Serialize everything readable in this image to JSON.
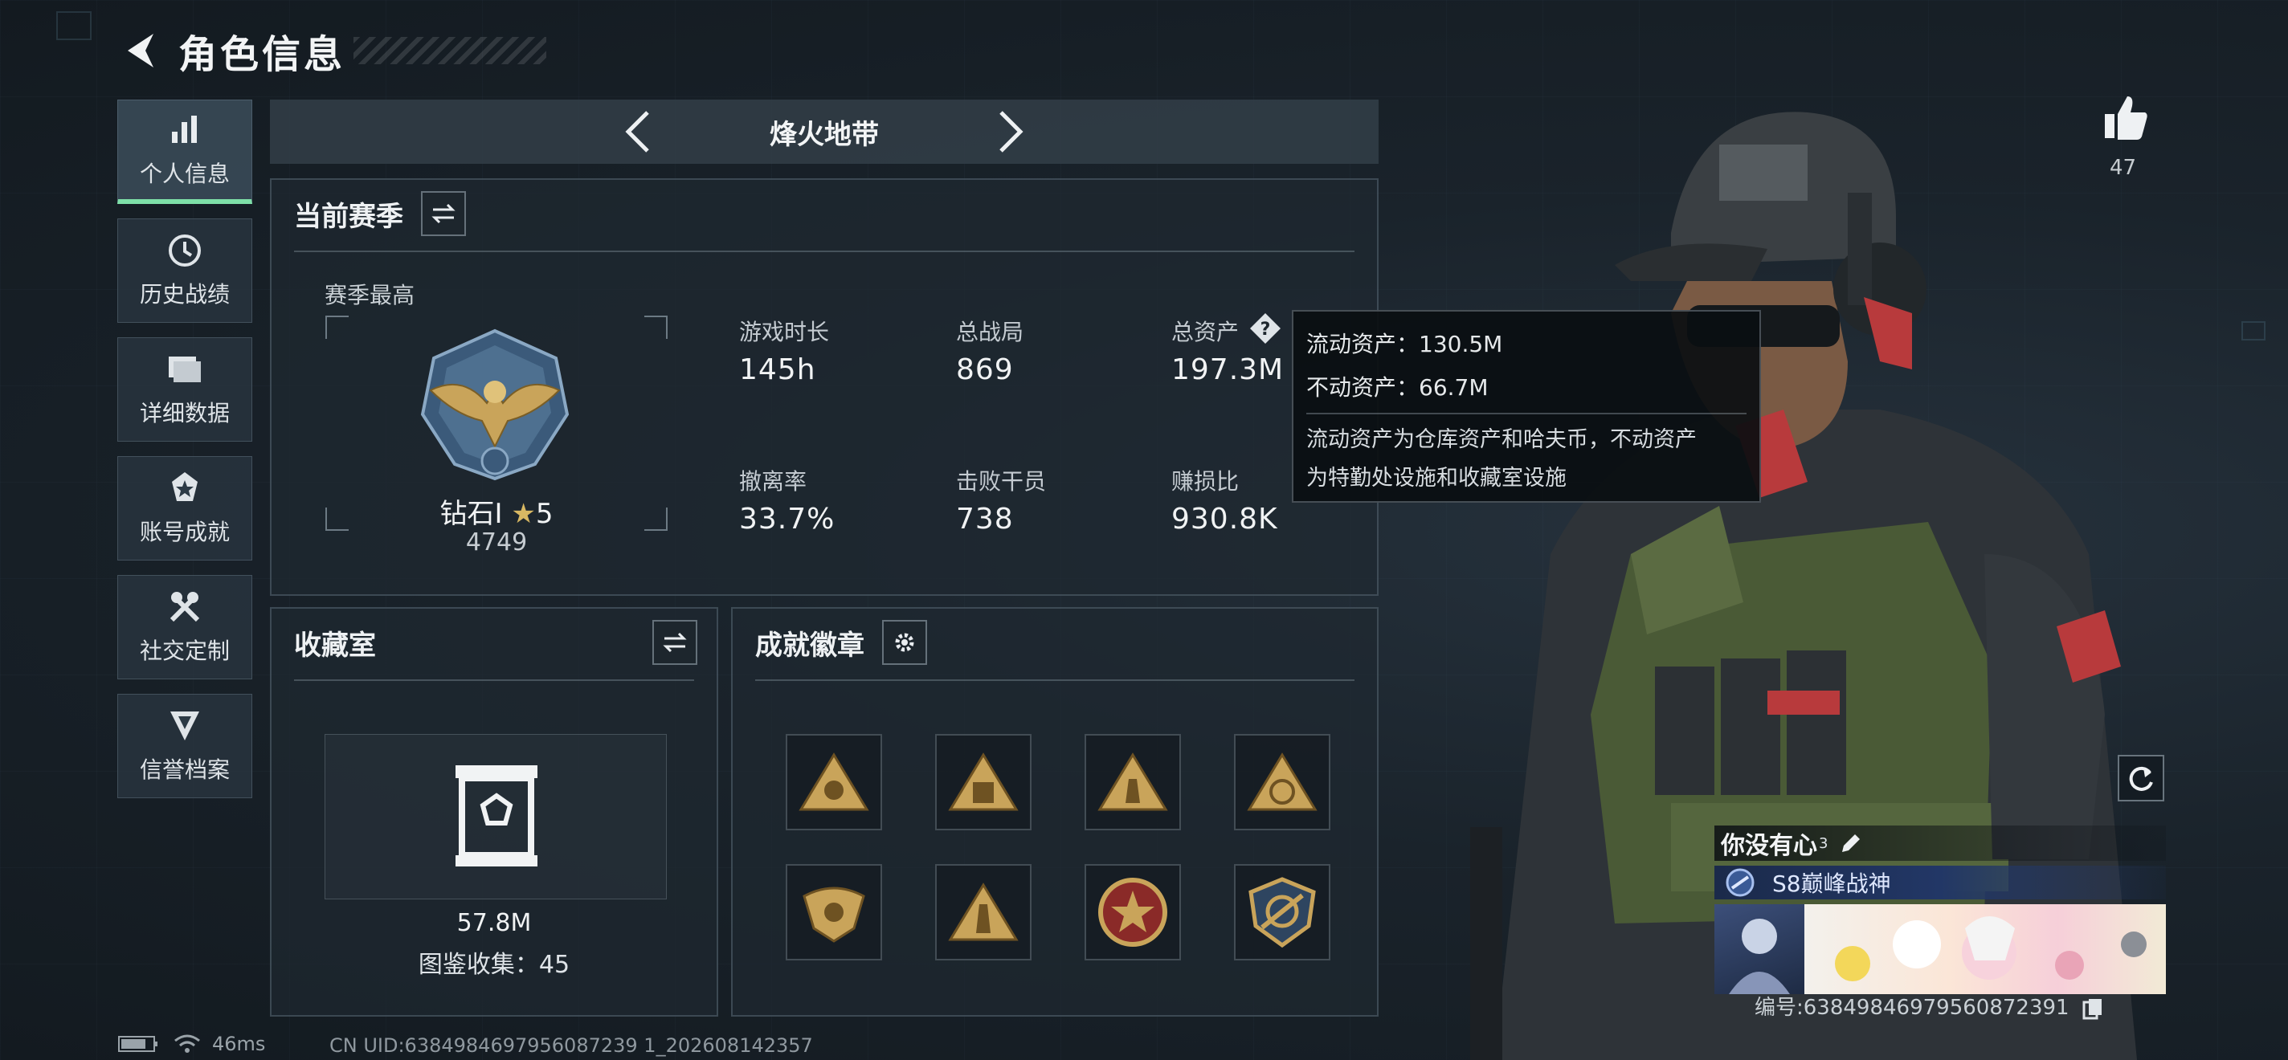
{
  "header": {
    "title": "角色信息"
  },
  "nav": {
    "items": [
      {
        "label": "个人信息",
        "icon": "bar-chart-icon",
        "active": true
      },
      {
        "label": "历史战绩",
        "icon": "history-icon"
      },
      {
        "label": "详细数据",
        "icon": "folder-icon"
      },
      {
        "label": "账号成就",
        "icon": "medal-icon"
      },
      {
        "label": "社交定制",
        "icon": "tools-icon"
      },
      {
        "label": "信誉档案",
        "icon": "shield-icon"
      }
    ]
  },
  "mode": {
    "label": "烽火地带"
  },
  "season": {
    "title": "当前赛季",
    "best_label": "赛季最高",
    "rank_name": "钻石I",
    "rank_stars": "5",
    "rank_score": "4749",
    "stats": [
      {
        "label": "游戏时长",
        "value": "145h"
      },
      {
        "label": "总战局",
        "value": "869"
      },
      {
        "label": "总资产",
        "value": "197.3M"
      },
      {
        "label": "撤离率",
        "value": "33.7%"
      },
      {
        "label": "击败干员",
        "value": "738"
      },
      {
        "label": "赚损比",
        "value": "930.8K"
      }
    ]
  },
  "tooltip": {
    "liquid": "流动资产：130.5M",
    "fixed": "不动资产：66.7M",
    "desc_line1": "流动资产为仓库资产和哈夫币，不动资产",
    "desc_line2": "为特勤处设施和收藏室设施"
  },
  "collection": {
    "title": "收藏室",
    "value": "57.8M",
    "count_text": "图鉴收集：45"
  },
  "achievements": {
    "title": "成就徽章",
    "badges": [
      "badge-1",
      "badge-2",
      "badge-3",
      "badge-4",
      "badge-5",
      "badge-6",
      "badge-7",
      "badge-8"
    ]
  },
  "likes": {
    "count": "47"
  },
  "player": {
    "name": "你没有心",
    "name_sup": "3",
    "title": "S8巅峰战神",
    "id_text": "编号:6384984697956087239​1"
  },
  "status": {
    "latency": "46ms",
    "uid": "CN UID:6384984697956087239 1_202608142357"
  },
  "colors": {
    "accent_green": "#7ee0a8",
    "gold": "#c9a45a",
    "panel_border": "#78909b"
  }
}
